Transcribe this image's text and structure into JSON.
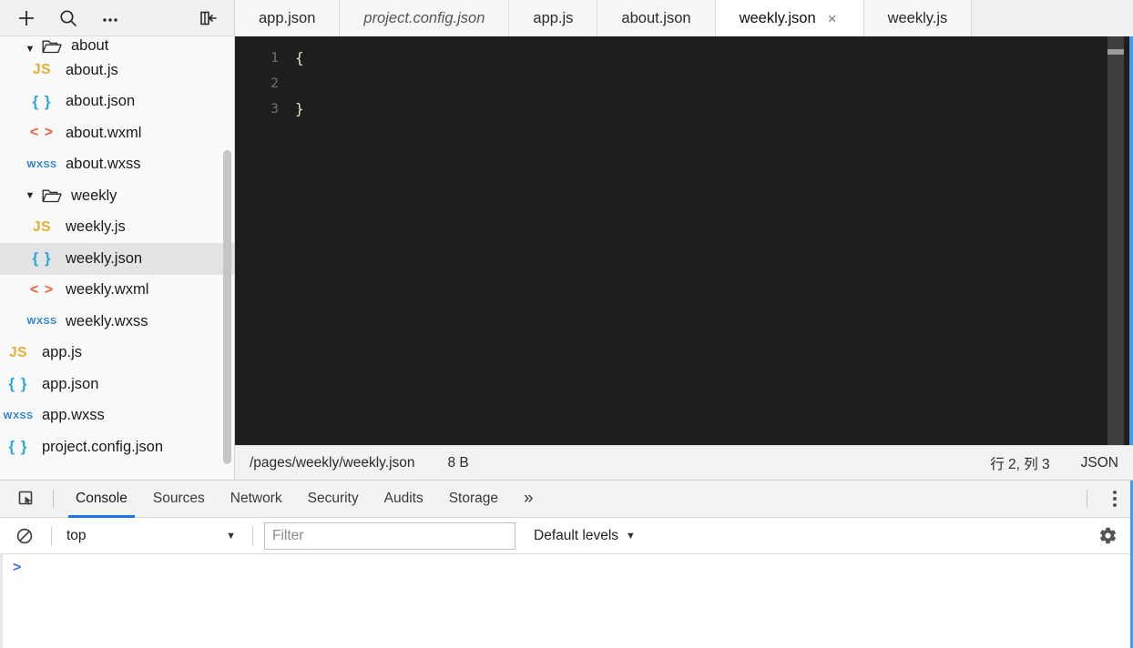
{
  "sidebar": {
    "toolbar": [
      {
        "name": "add-file-button",
        "icon": "plus-icon",
        "label": "+"
      },
      {
        "name": "search-button",
        "icon": "search-icon",
        "label": "Search"
      },
      {
        "name": "more-options-button",
        "icon": "ellipsis-icon",
        "label": "..."
      },
      {
        "name": "collapse-sidebar-button",
        "icon": "collapse-panel-icon",
        "label": "Collapse"
      }
    ],
    "tree": [
      {
        "label": "about",
        "type": "folder",
        "indent": 1,
        "expanded": true,
        "clipped": true,
        "selected": false
      },
      {
        "label": "about.js",
        "type": "js",
        "indent": 2,
        "selected": false
      },
      {
        "label": "about.json",
        "type": "json",
        "indent": 2,
        "selected": false
      },
      {
        "label": "about.wxml",
        "type": "wxml",
        "indent": 2,
        "selected": false
      },
      {
        "label": "about.wxss",
        "type": "wxss",
        "indent": 2,
        "selected": false
      },
      {
        "label": "weekly",
        "type": "folder",
        "indent": 1,
        "expanded": true,
        "clipped": false,
        "selected": false
      },
      {
        "label": "weekly.js",
        "type": "js",
        "indent": 2,
        "selected": false
      },
      {
        "label": "weekly.json",
        "type": "json",
        "indent": 2,
        "selected": true
      },
      {
        "label": "weekly.wxml",
        "type": "wxml",
        "indent": 2,
        "selected": false
      },
      {
        "label": "weekly.wxss",
        "type": "wxss",
        "indent": 2,
        "selected": false
      },
      {
        "label": "app.js",
        "type": "js",
        "indent": 1,
        "selected": false
      },
      {
        "label": "app.json",
        "type": "json",
        "indent": 1,
        "selected": false
      },
      {
        "label": "app.wxss",
        "type": "wxss",
        "indent": 1,
        "selected": false
      },
      {
        "label": "project.config.json",
        "type": "json",
        "indent": 1,
        "selected": false
      }
    ],
    "icon_text": {
      "js": "JS",
      "json": "{ }",
      "wxml": "< >",
      "wxss": "WXSS"
    },
    "twisty_expanded": "▼"
  },
  "editor": {
    "tabs": [
      {
        "label": "app.json",
        "active": false,
        "preview": false,
        "closable": false
      },
      {
        "label": "project.config.json",
        "active": false,
        "preview": true,
        "closable": false
      },
      {
        "label": "app.js",
        "active": false,
        "preview": false,
        "closable": false
      },
      {
        "label": "about.json",
        "active": false,
        "preview": false,
        "closable": false
      },
      {
        "label": "weekly.json",
        "active": true,
        "preview": false,
        "closable": true
      },
      {
        "label": "weekly.js",
        "active": false,
        "preview": false,
        "closable": false
      }
    ],
    "close_glyph": "×",
    "code": {
      "line_numbers": [
        "1",
        "2",
        "3"
      ],
      "lines": [
        "{",
        "",
        "}"
      ]
    }
  },
  "statusbar": {
    "path": "/pages/weekly/weekly.json",
    "size": "8 B",
    "cursor": "行 2, 列 3",
    "language": "JSON"
  },
  "devtools": {
    "inspect_icon": "inspect-element-icon",
    "tabs": [
      {
        "label": "Console",
        "active": true
      },
      {
        "label": "Sources",
        "active": false
      },
      {
        "label": "Network",
        "active": false
      },
      {
        "label": "Security",
        "active": false
      },
      {
        "label": "Audits",
        "active": false
      },
      {
        "label": "Storage",
        "active": false
      }
    ],
    "more_glyph": "»",
    "kebab_label": "More tools",
    "filterbar": {
      "clear_icon": "clear-console-icon",
      "context": "top",
      "context_caret": "▼",
      "filter_placeholder": "Filter",
      "filter_value": "",
      "levels": "Default levels",
      "levels_caret": "▼",
      "settings_icon": "gear-icon"
    },
    "console": {
      "prompt": ">",
      "input_value": ""
    }
  },
  "colors": {
    "accent_blue": "#1a73e8",
    "focus_blue": "#4a9ae8",
    "prompt_blue": "#3b78e7",
    "js_icon": "#e8ad33",
    "json_icon": "#29a8e0",
    "wxml_icon": "#e8603c",
    "wxss_icon": "#2a7fd4",
    "editor_bg": "#1e1e1e"
  }
}
